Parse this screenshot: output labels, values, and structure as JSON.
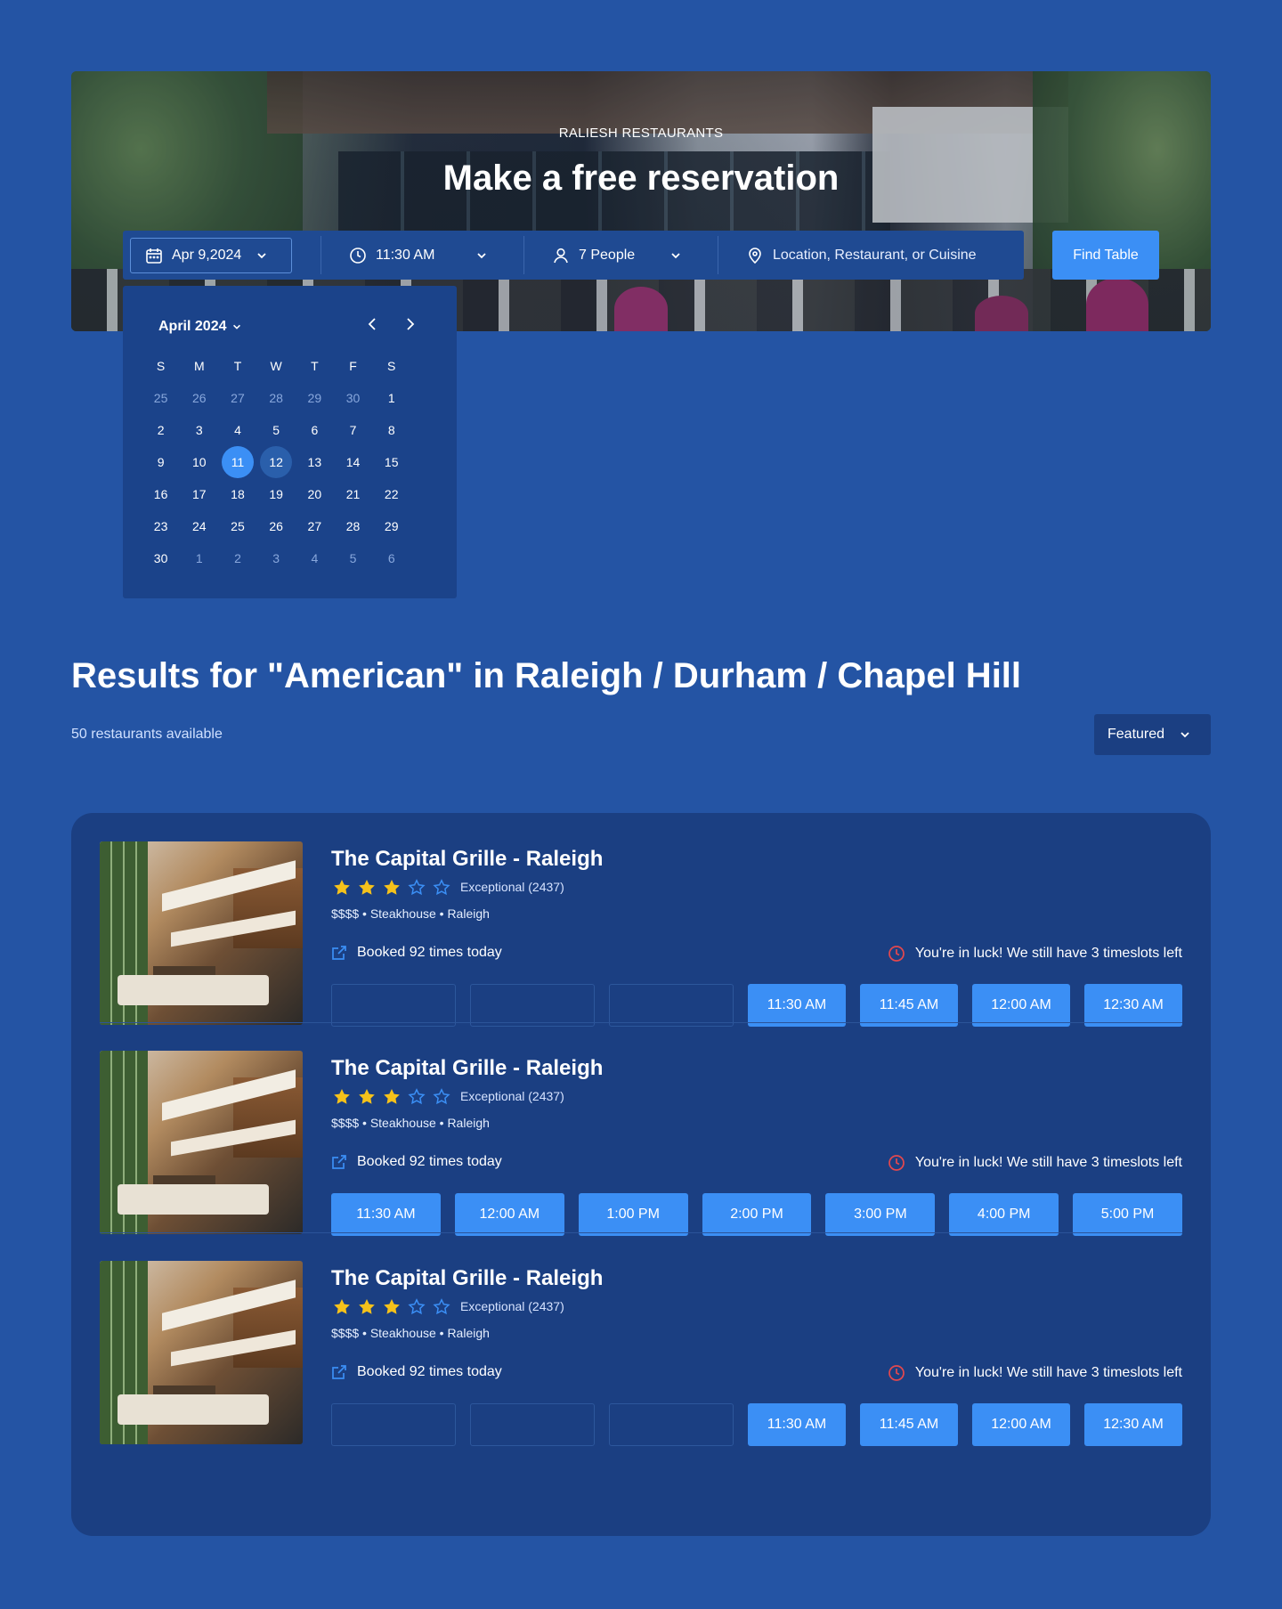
{
  "hero": {
    "brand": "RALIESH RESTAURANTS",
    "title": "Make a free reservation"
  },
  "search": {
    "date": "Apr 9,2024",
    "time": "11:30 AM",
    "people": "7 People",
    "location_placeholder": "Location, Restaurant, or Cuisine",
    "find_label": "Find Table"
  },
  "calendar": {
    "month_label": "April 2024",
    "weekdays": [
      "S",
      "M",
      "T",
      "W",
      "T",
      "F",
      "S"
    ],
    "weeks": [
      [
        "25",
        "26",
        "27",
        "28",
        "29",
        "30",
        "1"
      ],
      [
        "2",
        "3",
        "4",
        "5",
        "6",
        "7",
        "8"
      ],
      [
        "9",
        "10",
        "11",
        "12",
        "13",
        "14",
        "15"
      ],
      [
        "16",
        "17",
        "18",
        "19",
        "20",
        "21",
        "22"
      ],
      [
        "23",
        "24",
        "25",
        "26",
        "27",
        "28",
        "29"
      ],
      [
        "30",
        "1",
        "2",
        "3",
        "4",
        "5",
        "6"
      ]
    ],
    "selected_day": "11",
    "range_day": "12"
  },
  "results": {
    "title": "Results for \"American\" in Raleigh / Durham / Chapel Hill",
    "count": "50 restaurants available",
    "sort_label": "Featured"
  },
  "restaurants": [
    {
      "name": "The Capital Grille - Raleigh",
      "stars_filled": 3,
      "stars_total": 5,
      "rating_label": "Exceptional (2437)",
      "meta": "$$$$ • Steakhouse • Raleigh",
      "booked": "Booked 92 times today",
      "luck": "You're in luck! We still have 3 timeslots left",
      "slots": [
        "",
        "",
        "",
        "11:30 AM",
        "11:45 AM",
        "12:00 AM",
        "12:30 AM"
      ]
    },
    {
      "name": "The Capital Grille - Raleigh",
      "stars_filled": 3,
      "stars_total": 5,
      "rating_label": "Exceptional (2437)",
      "meta": "$$$$ • Steakhouse • Raleigh",
      "booked": "Booked 92 times today",
      "luck": "You're in luck! We still have 3 timeslots left",
      "slots": [
        "11:30 AM",
        "12:00 AM",
        "1:00 PM",
        "2:00 PM",
        "3:00 PM",
        "4:00 PM",
        "5:00 PM"
      ]
    },
    {
      "name": "The Capital Grille - Raleigh",
      "stars_filled": 3,
      "stars_total": 5,
      "rating_label": "Exceptional (2437)",
      "meta": "$$$$ • Steakhouse • Raleigh",
      "booked": "Booked 92 times today",
      "luck": "You're in luck! We still have 3 timeslots left",
      "slots": [
        "",
        "",
        "",
        "11:30 AM",
        "11:45 AM",
        "12:00 AM",
        "12:30 AM"
      ]
    }
  ],
  "colors": {
    "page_bg": "#2454a4",
    "panel_bg": "#1b3f82",
    "accent": "#3b8ff5",
    "star": "#f5c21b",
    "alert": "#e5484d"
  },
  "icons": [
    "calendar-icon",
    "chevron-down-icon",
    "clock-icon",
    "user-icon",
    "location-pin-icon",
    "chevron-left-icon",
    "chevron-right-icon",
    "star-icon",
    "external-link-icon",
    "clock-alert-icon"
  ]
}
